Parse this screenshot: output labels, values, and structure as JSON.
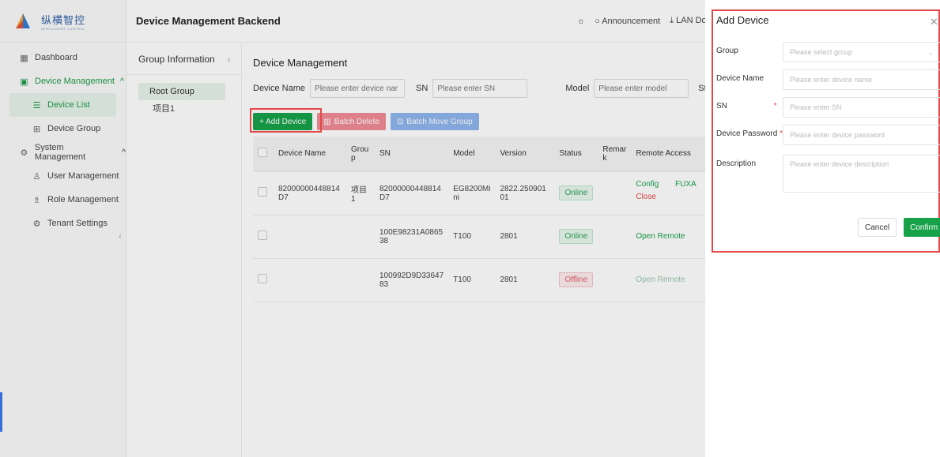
{
  "app": {
    "logo_text": "纵横智控",
    "logo_subtext": "INTELLIGENT CONTROL",
    "title": "Device Management Backend",
    "announcement": "Announcement",
    "lan_download": "LAN Dow"
  },
  "sidebar": {
    "items": [
      {
        "label": "Dashboard",
        "icon": "grid-icon"
      },
      {
        "label": "Device Management",
        "icon": "device-icon",
        "chevron": "^"
      },
      {
        "label": "Device List",
        "icon": "list-icon"
      },
      {
        "label": "Device Group",
        "icon": "group-icon"
      },
      {
        "label": "System Management",
        "icon": "settings-icon",
        "chevron": "^"
      },
      {
        "label": "User Management",
        "icon": "user-icon"
      },
      {
        "label": "Role Management",
        "icon": "role-icon"
      },
      {
        "label": "Tenant Settings",
        "icon": "gear-icon"
      }
    ]
  },
  "groups": {
    "title": "Group Information",
    "root": "Root Group",
    "child": "项目1"
  },
  "main": {
    "title": "Device Management",
    "filters": {
      "device_name_label": "Device Name",
      "device_name_placeholder": "Please enter device nar",
      "sn_label": "SN",
      "sn_placeholder": "Please enter SN",
      "model_label": "Model",
      "model_placeholder": "Please enter model",
      "status_label": "Stat"
    },
    "buttons": {
      "add": "+ Add Device",
      "batch_delete": "Batch Delete",
      "batch_move": "Batch Move Group"
    },
    "table": {
      "headers": [
        "Device Name",
        "Grou p",
        "SN",
        "Model",
        "Version",
        "Status",
        "Remar k",
        "Remote Access"
      ],
      "rows": [
        {
          "name": "82000000448814 D7",
          "group": "项目1",
          "sn": "82000000448814 D7",
          "model": "EG8200Mi ni",
          "version": "2822.250901 01",
          "status": "Online",
          "remark": "",
          "access_config": "Config",
          "access_extra": "FUXA",
          "access_close": "Close"
        },
        {
          "name": "",
          "group": "",
          "sn": "100E98231A0865 38",
          "model": "T100",
          "version": "2801",
          "status": "Online",
          "remark": "",
          "access_open": "Open Remote"
        },
        {
          "name": "",
          "group": "",
          "sn": "100992D9D33647 83",
          "model": "T100",
          "version": "2801",
          "status": "Offline",
          "remark": "",
          "access_open": "Open Remote"
        }
      ]
    }
  },
  "drawer": {
    "title": "Add Device",
    "fields": {
      "group_label": "Group",
      "group_placeholder": "Please select group",
      "name_label": "Device Name",
      "name_placeholder": "Please enter device name",
      "sn_label": "SN",
      "sn_placeholder": "Please enter SN",
      "password_label": "Device Password",
      "password_placeholder": "Please enter device password",
      "description_label": "Description",
      "description_placeholder": "Please enter device description"
    },
    "required_mark": "*",
    "cancel": "Cancel",
    "confirm": "Confirm"
  },
  "colors": {
    "primary": "#17a24a",
    "danger": "#e44848",
    "highlight_border": "#e44848"
  }
}
